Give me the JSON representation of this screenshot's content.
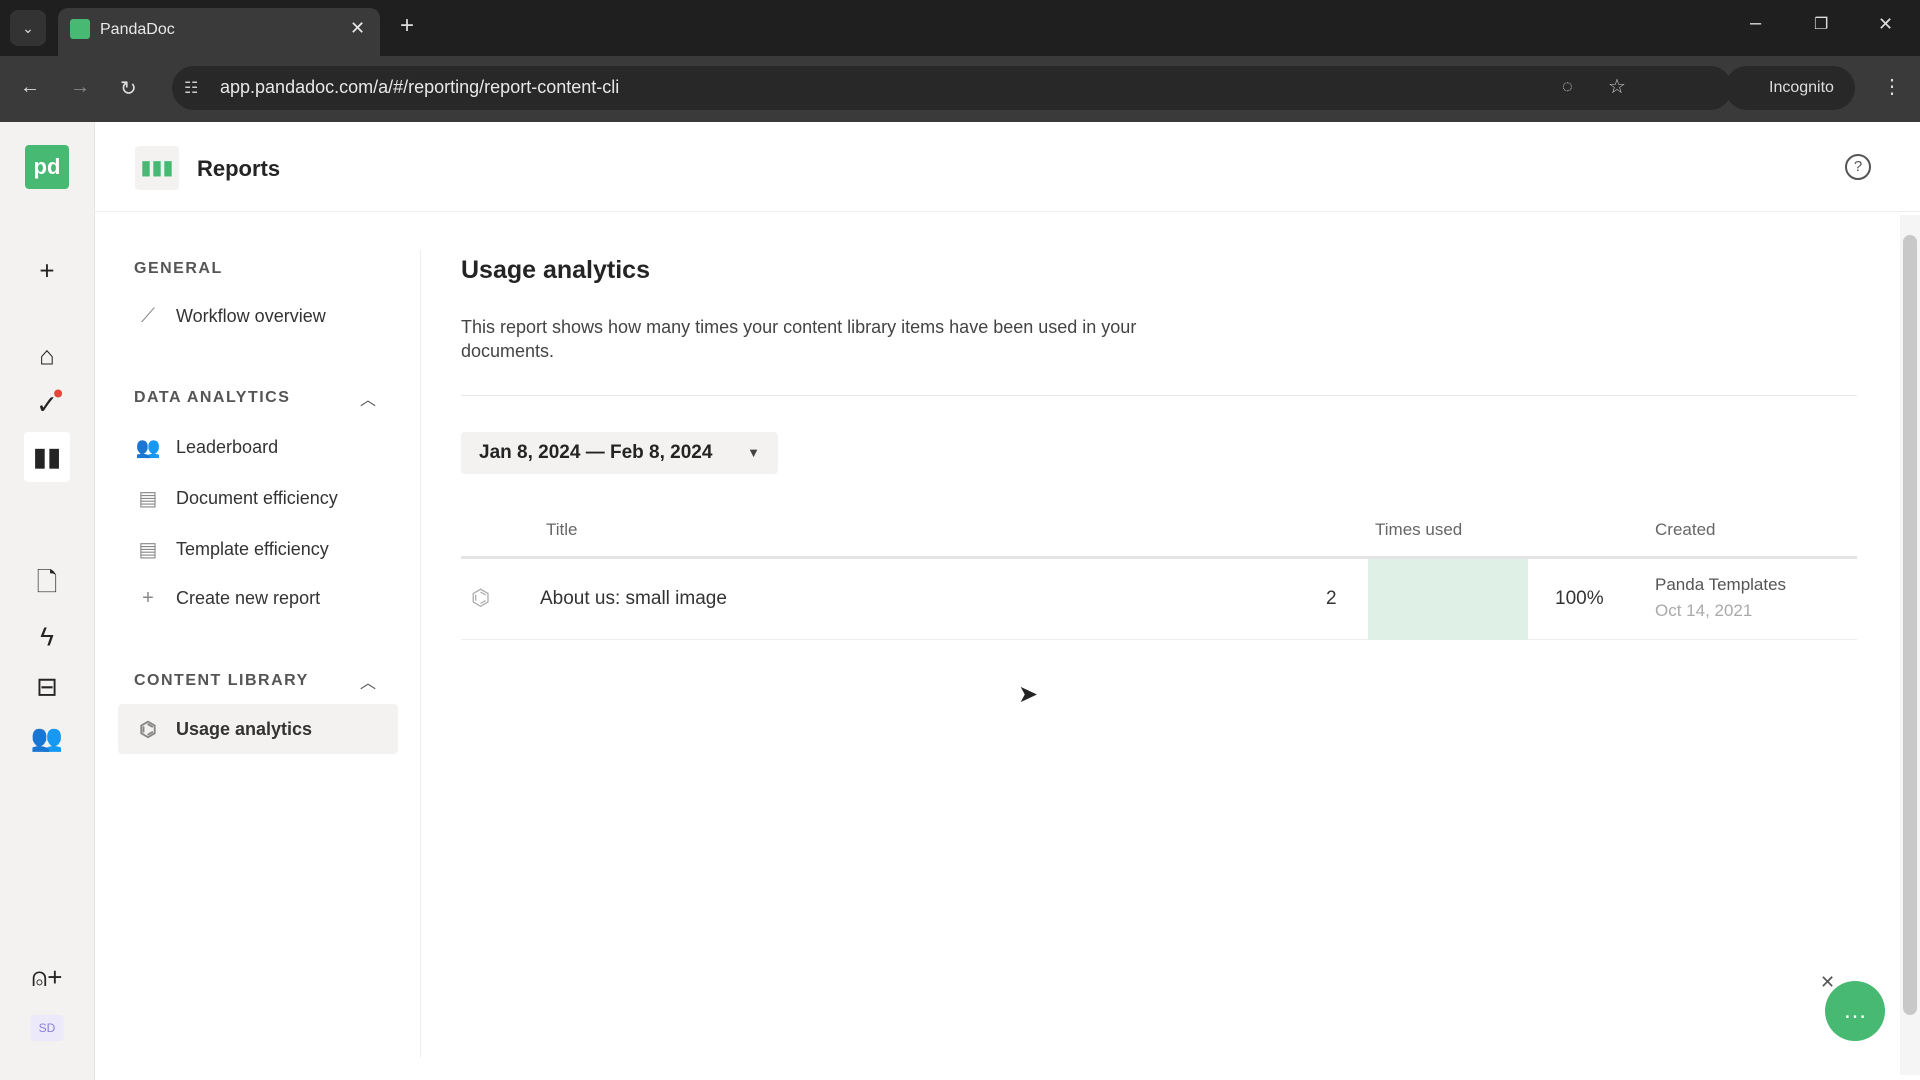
{
  "browser": {
    "tab_title": "PandaDoc",
    "url": "app.pandadoc.com/a/#/reporting/report-content-cli",
    "incognito_label": "Incognito"
  },
  "header": {
    "title": "Reports"
  },
  "rail": {
    "avatar_initials": "SD"
  },
  "sidebar": {
    "general": {
      "label": "GENERAL",
      "items": [
        {
          "label": "Workflow overview"
        }
      ]
    },
    "data_analytics": {
      "label": "DATA ANALYTICS",
      "items": [
        {
          "label": "Leaderboard"
        },
        {
          "label": "Document efficiency"
        },
        {
          "label": "Template efficiency"
        },
        {
          "label": "Create new report"
        }
      ]
    },
    "content_library": {
      "label": "CONTENT LIBRARY",
      "items": [
        {
          "label": "Usage analytics"
        }
      ]
    }
  },
  "main": {
    "title": "Usage analytics",
    "description": "This report shows how many times your content library items have been used in your documents.",
    "date_range": "Jan 8, 2024 — Feb 8, 2024",
    "table": {
      "headers": {
        "title": "Title",
        "times_used": "Times used",
        "created": "Created"
      },
      "rows": [
        {
          "title": "About us: small image",
          "times_used": "2",
          "percent": "100%",
          "percent_value": 100,
          "created_by": "Panda Templates",
          "created_date": "Oct 14, 2021"
        }
      ]
    }
  },
  "colors": {
    "brand": "#47b972",
    "bar": "#dff0e6"
  }
}
